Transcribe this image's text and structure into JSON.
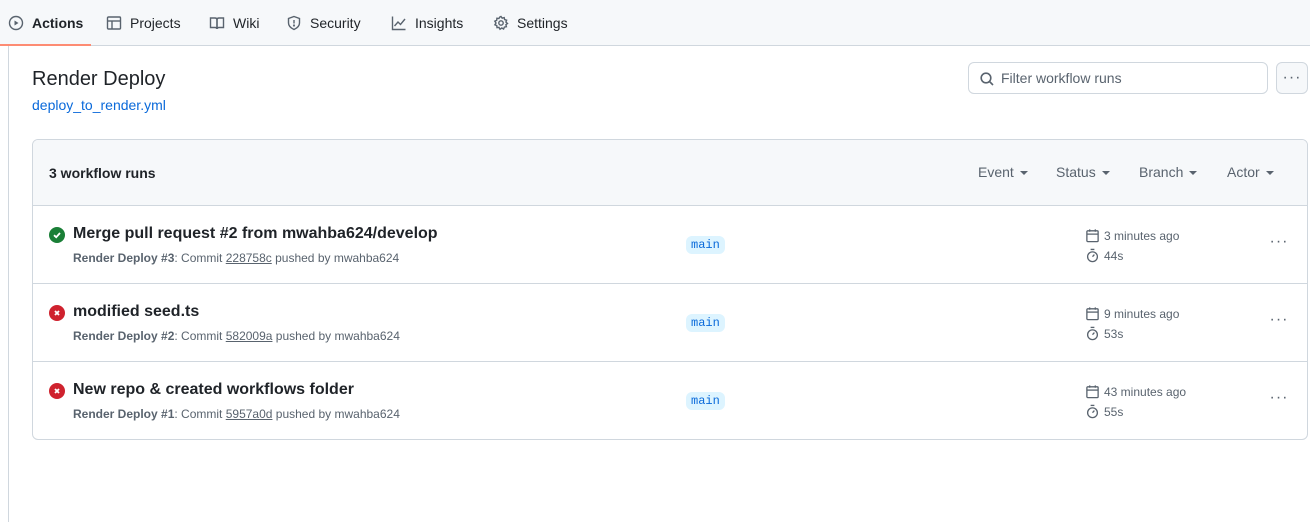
{
  "nav": {
    "tabs": [
      {
        "label": "Actions",
        "icon": "play-circle-icon"
      },
      {
        "label": "Projects",
        "icon": "table-icon"
      },
      {
        "label": "Wiki",
        "icon": "book-icon"
      },
      {
        "label": "Security",
        "icon": "shield-icon"
      },
      {
        "label": "Insights",
        "icon": "graph-icon"
      },
      {
        "label": "Settings",
        "icon": "gear-icon"
      }
    ],
    "active": "Actions"
  },
  "workflow": {
    "title": "Render Deploy",
    "file": "deploy_to_render.yml"
  },
  "search": {
    "placeholder": "Filter workflow runs"
  },
  "more_label": "···",
  "runs": {
    "count_label": "3 workflow runs",
    "filters": [
      "Event",
      "Status",
      "Branch",
      "Actor"
    ],
    "items": [
      {
        "status": "success",
        "title": "Merge pull request #2 from mwahba624/develop",
        "workflow": "Render Deploy",
        "run_number": "#3",
        "commit_prefix": ": Commit ",
        "sha": "228758c",
        "pushed_by": " pushed by mwahba624",
        "branch": "main",
        "time": "3 minutes ago",
        "duration": "44s"
      },
      {
        "status": "failure",
        "title": "modified seed.ts",
        "workflow": "Render Deploy",
        "run_number": "#2",
        "commit_prefix": ": Commit ",
        "sha": "582009a",
        "pushed_by": " pushed by mwahba624",
        "branch": "main",
        "time": "9 minutes ago",
        "duration": "53s"
      },
      {
        "status": "failure",
        "title": "New repo & created workflows folder",
        "workflow": "Render Deploy",
        "run_number": "#1",
        "commit_prefix": ": Commit ",
        "sha": "5957a0d",
        "pushed_by": " pushed by mwahba624",
        "branch": "main",
        "time": "43 minutes ago",
        "duration": "55s"
      }
    ]
  },
  "colors": {
    "success": "#1a7f37",
    "failure": "#cf222e",
    "accent": "#fd8c73",
    "link": "#0969da"
  }
}
